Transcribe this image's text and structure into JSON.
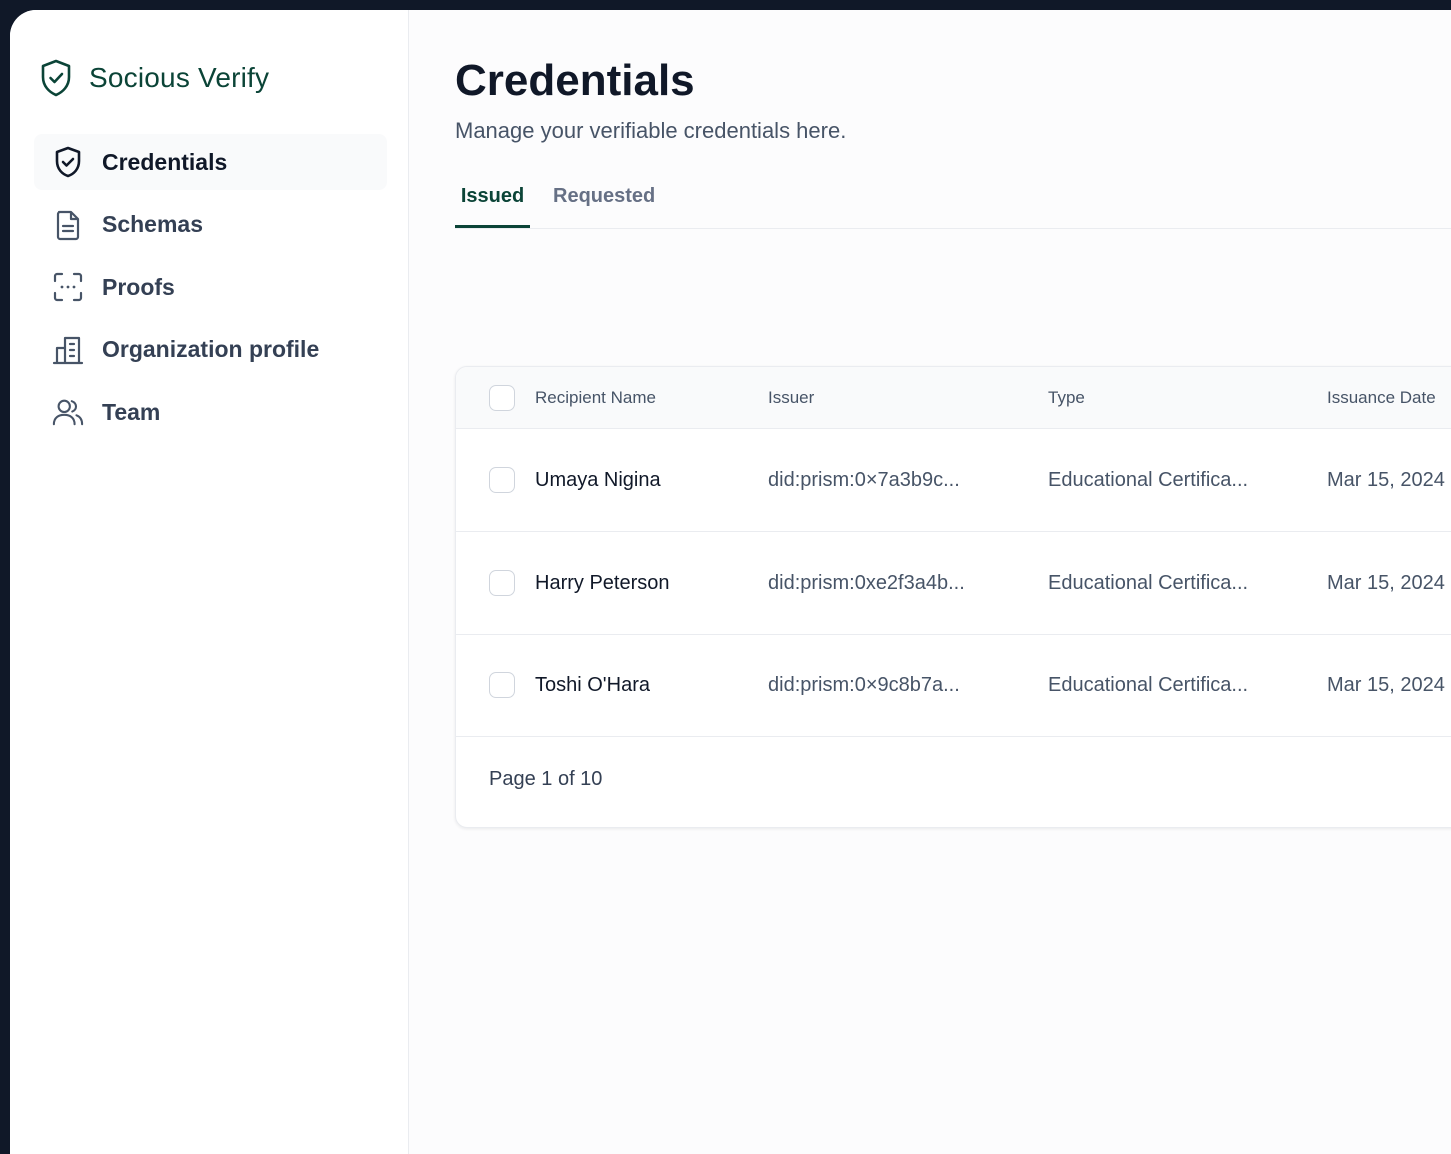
{
  "brand": {
    "name": "Socious Verify",
    "icon": "shield-check-icon",
    "color": "#0b4437"
  },
  "sidebar": {
    "items": [
      {
        "label": "Credentials",
        "icon": "shield-check-icon",
        "active": true
      },
      {
        "label": "Schemas",
        "icon": "document-icon",
        "active": false
      },
      {
        "label": "Proofs",
        "icon": "scan-icon",
        "active": false
      },
      {
        "label": "Organization profile",
        "icon": "building-icon",
        "active": false
      },
      {
        "label": "Team",
        "icon": "users-icon",
        "active": false
      }
    ]
  },
  "main": {
    "title": "Credentials",
    "subtitle": "Manage your verifiable credentials here.",
    "tabs": [
      {
        "label": "Issued",
        "active": true
      },
      {
        "label": "Requested",
        "active": false
      }
    ]
  },
  "table": {
    "columns": [
      "Recipient Name",
      "Issuer",
      "Type",
      "Issuance Date"
    ],
    "rows": [
      {
        "name": "Umaya Nigina",
        "issuer": "did:prism:0×7a3b9c...",
        "type": "Educational Certifica...",
        "date": "Mar 15, 2024"
      },
      {
        "name": "Harry Peterson",
        "issuer": "did:prism:0xe2f3a4b...",
        "type": "Educational Certifica...",
        "date": "Mar 15, 2024"
      },
      {
        "name": "Toshi O'Hara",
        "issuer": "did:prism:0×9c8b7a...",
        "type": "Educational Certifica...",
        "date": "Mar 15, 2024"
      }
    ],
    "pagination": "Page 1 of 10"
  },
  "colors": {
    "accent": "#0b4437",
    "text": "#101828",
    "muted": "#475467",
    "border": "#eaecf0",
    "frame": "#101828"
  }
}
